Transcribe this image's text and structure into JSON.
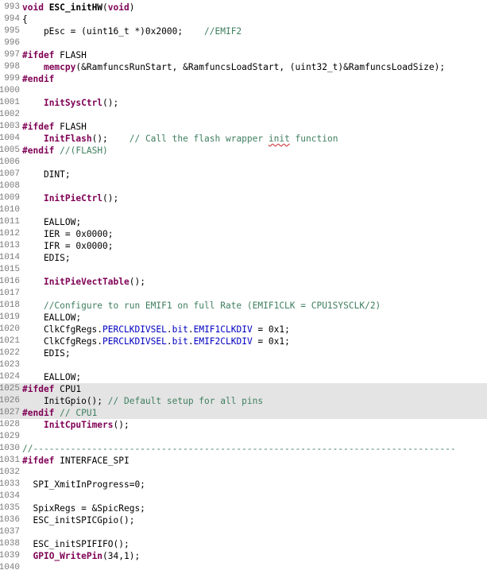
{
  "lines": [
    {
      "no": "993",
      "segs": [
        {
          "t": "void ",
          "c": "kw"
        },
        {
          "t": "ESC_initHW",
          "c": "fnb"
        },
        {
          "t": "(",
          "c": ""
        },
        {
          "t": "void",
          "c": "kw"
        },
        {
          "t": ")",
          "c": ""
        }
      ]
    },
    {
      "no": "994",
      "segs": [
        {
          "t": "{",
          "c": ""
        }
      ]
    },
    {
      "no": "995",
      "segs": [
        {
          "t": "    pEsc = (uint16_t *)0x2000;    ",
          "c": ""
        },
        {
          "t": "//EMIF2",
          "c": "cm"
        }
      ]
    },
    {
      "no": "996",
      "segs": []
    },
    {
      "no": "997",
      "segs": [
        {
          "t": "#ifdef",
          "c": "pp"
        },
        {
          "t": " FLASH",
          "c": ""
        }
      ]
    },
    {
      "no": "998",
      "segs": [
        {
          "t": "    ",
          "c": ""
        },
        {
          "t": "memcpy",
          "c": "fn"
        },
        {
          "t": "(&RamfuncsRunStart, &RamfuncsLoadStart, (uint32_t)&RamfuncsLoadSize);",
          "c": ""
        }
      ]
    },
    {
      "no": "999",
      "segs": [
        {
          "t": "#endif",
          "c": "pp"
        }
      ]
    },
    {
      "no": "1000",
      "segs": []
    },
    {
      "no": "1001",
      "segs": [
        {
          "t": "    ",
          "c": ""
        },
        {
          "t": "InitSysCtrl",
          "c": "fn"
        },
        {
          "t": "();",
          "c": ""
        }
      ]
    },
    {
      "no": "1002",
      "segs": []
    },
    {
      "no": "1003",
      "segs": [
        {
          "t": "#ifdef",
          "c": "pp"
        },
        {
          "t": " FLASH",
          "c": ""
        }
      ]
    },
    {
      "no": "1004",
      "segs": [
        {
          "t": "    ",
          "c": ""
        },
        {
          "t": "InitFlash",
          "c": "fn"
        },
        {
          "t": "();    ",
          "c": ""
        },
        {
          "t": "// Call the flash wrapper ",
          "c": "cm"
        },
        {
          "t": "init",
          "c": "cm squig"
        },
        {
          "t": " function",
          "c": "cm"
        }
      ]
    },
    {
      "no": "1005",
      "segs": [
        {
          "t": "#endif",
          "c": "pp"
        },
        {
          "t": " ",
          "c": ""
        },
        {
          "t": "//(FLASH)",
          "c": "cm"
        }
      ]
    },
    {
      "no": "1006",
      "segs": []
    },
    {
      "no": "1007",
      "segs": [
        {
          "t": "    DINT;",
          "c": ""
        }
      ]
    },
    {
      "no": "1008",
      "segs": []
    },
    {
      "no": "1009",
      "segs": [
        {
          "t": "    ",
          "c": ""
        },
        {
          "t": "InitPieCtrl",
          "c": "fn"
        },
        {
          "t": "();",
          "c": ""
        }
      ]
    },
    {
      "no": "1010",
      "segs": []
    },
    {
      "no": "1011",
      "segs": [
        {
          "t": "    EALLOW;",
          "c": ""
        }
      ]
    },
    {
      "no": "1012",
      "segs": [
        {
          "t": "    IER = 0x0000;",
          "c": ""
        }
      ]
    },
    {
      "no": "1013",
      "segs": [
        {
          "t": "    IFR = 0x0000;",
          "c": ""
        }
      ]
    },
    {
      "no": "1014",
      "segs": [
        {
          "t": "    EDIS;",
          "c": ""
        }
      ]
    },
    {
      "no": "1015",
      "segs": []
    },
    {
      "no": "1016",
      "segs": [
        {
          "t": "    ",
          "c": ""
        },
        {
          "t": "InitPieVectTable",
          "c": "fn"
        },
        {
          "t": "();",
          "c": ""
        }
      ]
    },
    {
      "no": "1017",
      "segs": []
    },
    {
      "no": "1018",
      "segs": [
        {
          "t": "    ",
          "c": ""
        },
        {
          "t": "//Configure to run EMIF1 on full Rate (EMIF1CLK = CPU1SYSCLK/2)",
          "c": "cm"
        }
      ]
    },
    {
      "no": "1019",
      "segs": [
        {
          "t": "    EALLOW;",
          "c": ""
        }
      ]
    },
    {
      "no": "1020",
      "segs": [
        {
          "t": "    ClkCfgRegs.",
          "c": ""
        },
        {
          "t": "PERCLKDIVSEL",
          "c": "fld"
        },
        {
          "t": ".",
          "c": ""
        },
        {
          "t": "bit",
          "c": "fld"
        },
        {
          "t": ".",
          "c": ""
        },
        {
          "t": "EMIF1CLKDIV",
          "c": "fld"
        },
        {
          "t": " = 0x1;",
          "c": ""
        }
      ]
    },
    {
      "no": "1021",
      "segs": [
        {
          "t": "    ClkCfgRegs.",
          "c": ""
        },
        {
          "t": "PERCLKDIVSEL",
          "c": "fld"
        },
        {
          "t": ".",
          "c": ""
        },
        {
          "t": "bit",
          "c": "fld"
        },
        {
          "t": ".",
          "c": ""
        },
        {
          "t": "EMIF2CLKDIV",
          "c": "fld"
        },
        {
          "t": " = 0x1;",
          "c": ""
        }
      ]
    },
    {
      "no": "1022",
      "segs": [
        {
          "t": "    EDIS;",
          "c": ""
        }
      ]
    },
    {
      "no": "1023",
      "segs": []
    },
    {
      "no": "1024",
      "segs": [
        {
          "t": "    EALLOW;",
          "c": ""
        }
      ]
    },
    {
      "no": "1025",
      "hl": true,
      "segs": [
        {
          "t": "#ifdef",
          "c": "pp"
        },
        {
          "t": " CPU1",
          "c": ""
        }
      ]
    },
    {
      "no": "1026",
      "hl": true,
      "segs": [
        {
          "t": "    InitGpio(); ",
          "c": ""
        },
        {
          "t": "// Default setup for all pins",
          "c": "cm"
        }
      ]
    },
    {
      "no": "1027",
      "hl": true,
      "segs": [
        {
          "t": "#endif",
          "c": "pp"
        },
        {
          "t": " ",
          "c": ""
        },
        {
          "t": "// CPU1",
          "c": "cm"
        }
      ]
    },
    {
      "no": "1028",
      "segs": [
        {
          "t": "    ",
          "c": ""
        },
        {
          "t": "InitCpuTimers",
          "c": "fn"
        },
        {
          "t": "();",
          "c": ""
        }
      ]
    },
    {
      "no": "1029",
      "segs": []
    },
    {
      "no": "1030",
      "segs": [
        {
          "t": "//-------------------------------------------------------------------------------",
          "c": "cm"
        }
      ]
    },
    {
      "no": "1031",
      "segs": [
        {
          "t": "#ifdef",
          "c": "pp"
        },
        {
          "t": " INTERFACE_SPI",
          "c": ""
        }
      ]
    },
    {
      "no": "1032",
      "segs": []
    },
    {
      "no": "1033",
      "segs": [
        {
          "t": "  SPI_XmitInProgress=0;",
          "c": ""
        }
      ]
    },
    {
      "no": "1034",
      "segs": []
    },
    {
      "no": "1035",
      "segs": [
        {
          "t": "  SpixRegs = &SpicRegs;",
          "c": ""
        }
      ]
    },
    {
      "no": "1036",
      "segs": [
        {
          "t": "  ESC_initSPICGpio();",
          "c": ""
        }
      ]
    },
    {
      "no": "1037",
      "segs": []
    },
    {
      "no": "1038",
      "segs": [
        {
          "t": "  ESC_initSPIFIFO();",
          "c": ""
        }
      ]
    },
    {
      "no": "1039",
      "segs": [
        {
          "t": "  ",
          "c": ""
        },
        {
          "t": "GPIO_WritePin",
          "c": "fn"
        },
        {
          "t": "(34,1);",
          "c": ""
        }
      ]
    },
    {
      "no": "1040",
      "segs": []
    }
  ]
}
